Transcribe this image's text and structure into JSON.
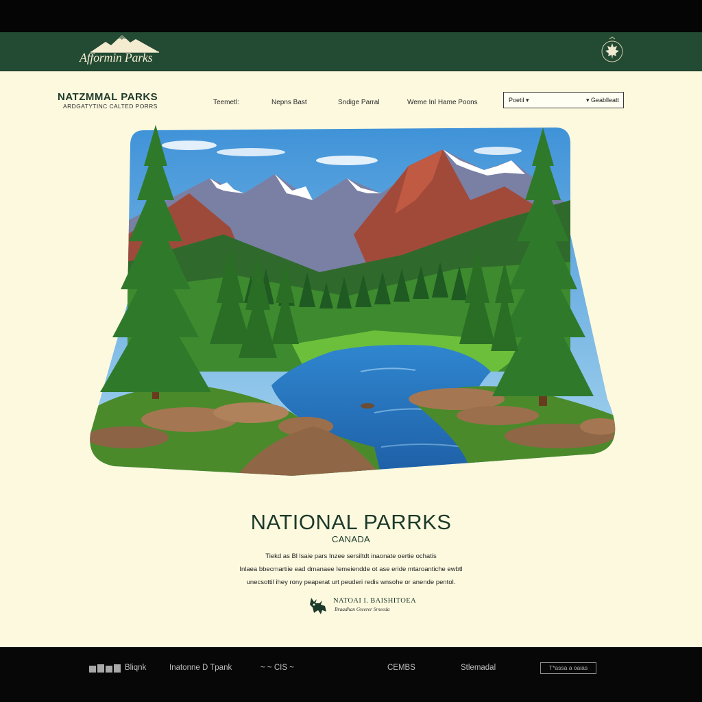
{
  "header": {
    "logo_text": "Afformin Parks",
    "emblem_icon": "maple-leaf-emblem-icon",
    "background_color": "#234a33"
  },
  "brand": {
    "title": "NATZMMAL PARKS",
    "subtitle": "ARDGATYTINC CALTED PORRS"
  },
  "nav": {
    "items": [
      {
        "label": "Teemetl:"
      },
      {
        "label": "Nepns Bast"
      },
      {
        "label": "Sndige Parral"
      },
      {
        "label": "Weme Inl Hame Poons"
      }
    ]
  },
  "select": {
    "left_value": "Poetil ▾",
    "right_value": "▾ Geablleatt"
  },
  "hero": {
    "image_description_icon": "mountain-river-forest-illustration"
  },
  "main": {
    "title": "NATIONAL PARRKS",
    "subtitle": "CANADA",
    "description_lines": [
      "Tiekd as Bl lsaie pars Inzee sersiltdt inaonate oertie ochatis",
      "Inlaea bbecmartiie ead dmanaee Iemeiendde ot ase eride mtaroantiche ewbtl",
      "unecsottil ihey rony peaperat urt peuderi redis wnsohe or anende pentol."
    ]
  },
  "badge": {
    "title": "NATOAI I. BAISHITOEA",
    "subtitle": "Braadhan  Gteerer  Srseeda",
    "icon": "moose-emblem-icon"
  },
  "footer": {
    "items": [
      {
        "label": "Bliqnk"
      },
      {
        "label": "Inatonne D Tpank"
      },
      {
        "label": "~ ~ CIS ~"
      },
      {
        "label": "CEMBS"
      },
      {
        "label": "Stlemadal"
      }
    ],
    "box_label": "T*assa a oaias"
  },
  "colors": {
    "page_background": "#fdf9df",
    "header_green": "#234a33",
    "title_green": "#1c3a2a",
    "footer_black": "#070707"
  }
}
